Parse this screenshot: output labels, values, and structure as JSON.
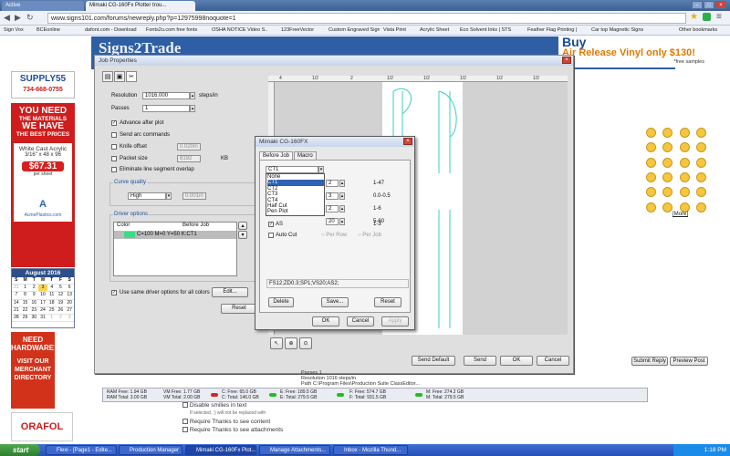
{
  "browser": {
    "tabs": [
      "Active",
      "Mimaki CG-160Fx Plotter trou..."
    ],
    "url": "www.signs101.com/forums/newreply.php?p=12975998noquote=1",
    "bookmarks": [
      "Sign Vox",
      "BCEonline",
      "dafont.com - Download",
      "Fonts2u.com free fonts",
      "OSHA NOTICE Video S..",
      "123FreeVector",
      "Custom Engraved Signs",
      "Vista Print",
      "Acrylic Sheet",
      "Eco Solvent Inks | STS",
      "Feather Flag Printing |",
      "Car top Magnetic Signs",
      "Other bookmarks"
    ]
  },
  "webpage": {
    "banner_brand": "Signs2Trade",
    "banner_ad": {
      "buy": "Buy",
      "release": "Air Release Vinyl only $130!",
      "free": "*free samples"
    },
    "supply_ad": {
      "name": "SUPPLY55",
      "phone": "734-668-0755"
    },
    "red_ad": {
      "line1": "YOU NEED",
      "line2": "THE MATERIALS",
      "line3": "WE HAVE",
      "line4": "THE BEST PRICES",
      "product": "White Cast Acrylic",
      "size": "3/16\" x 48 x 96",
      "price": "$67.31",
      "unit": "per sheet",
      "brand": "AcmePlastics.com"
    },
    "calendar": {
      "title": "August 2016",
      "days": [
        "S",
        "M",
        "T",
        "W",
        "T",
        "F",
        "S"
      ],
      "dates": [
        "31",
        "1",
        "2",
        "3",
        "4",
        "5",
        "6",
        "7",
        "8",
        "9",
        "10",
        "11",
        "12",
        "13",
        "14",
        "15",
        "16",
        "17",
        "18",
        "19",
        "20",
        "21",
        "22",
        "23",
        "24",
        "25",
        "26",
        "27",
        "28",
        "29",
        "30",
        "31",
        "1",
        "2",
        "3"
      ]
    },
    "hw_ad": [
      "NEED",
      "HARDWARE?",
      "VISIT OUR",
      "MERCHANT",
      "DIRECTORY"
    ],
    "orafol": "ORAFOL",
    "more_link": "[More]",
    "reply_buttons": [
      "Submit Reply",
      "Preview Post"
    ],
    "post_options": [
      "Disable smilies in text",
      "If selected, :) will not be replaced with",
      "Require Thanks to see content",
      "Require Thanks to see attachments"
    ]
  },
  "job_properties": {
    "title": "Job Properties",
    "resolution_label": "Resolution",
    "resolution_value": "1016.000",
    "resolution_unit": "steps/in",
    "passes_label": "Passes",
    "passes_value": "1",
    "advance_after_plot": "Advance after plot",
    "send_arc": "Send arc commands",
    "knife_offset": "Knife offset",
    "knife_offset_value": "0.020in",
    "packet_size": "Packet size",
    "packet_size_value": "8192",
    "packet_unit": "KB",
    "eliminate": "Eliminate line segment overlap",
    "curve_quality": "Curve quality",
    "curve_value": "High",
    "curve_extra": "0.001in",
    "driver_options": "Driver options",
    "col_color": "Color",
    "col_before": "Before Job",
    "row_value": "C=100 M=0 Y=50 K:CT1",
    "same_driver": "Use same driver options for all colors",
    "edit_btn": "Edit...",
    "reset_btn": "Reset",
    "ruler_marks": [
      "4",
      "1/2",
      "2",
      "1/2",
      "1/2",
      "1/2",
      "1/2",
      "1/2"
    ],
    "bottom_buttons": [
      "Send Default",
      "Send",
      "OK",
      "Cancel"
    ]
  },
  "mimaki": {
    "title": "Mimaki CG-160FX",
    "tabs": [
      "Before Job",
      "Macro"
    ],
    "ct_value": "CT1",
    "list": [
      "None",
      "CT1",
      "CT2",
      "CT3",
      "CT4",
      "Half Cut",
      "Pen Plot"
    ],
    "rows": [
      {
        "val": "2",
        "range": "1-47"
      },
      {
        "val": "3",
        "range": "0.0-0.5"
      },
      {
        "val": "2",
        "range": "1-6"
      },
      {
        "val": "20",
        "range": "5-60"
      },
      {
        "val": "2",
        "range": "1-3"
      }
    ],
    "as_label": "AS",
    "auto_cut": "Auto Cut",
    "per_row": "Per Row",
    "per_job": "Per Job",
    "command": "FS12;ZD0.3;SP1;VS20;AS2;",
    "delete_btn": "Delete",
    "save_btn": "Save...",
    "reset_btn": "Reset",
    "ok_btn": "OK",
    "cancel_btn": "Cancel",
    "apply_btn": "Apply"
  },
  "status": {
    "ram_free": "RAM Free: 1.94 GB",
    "ram_total": "RAM Total: 3.00 GB",
    "vm_free": "VM Free: 1.77 GB",
    "vm_total": "VM Total: 2.00 GB",
    "c_free": "C: Free: 65.0 GB",
    "c_total": "C: Total: 146.0 GB",
    "e_free": "E: Free: 189.5 GB",
    "e_total": "E: Total: 279.5 GB",
    "f_free": "F: Free: 574.7 GB",
    "f_total": "F: Total: 931.5 GB",
    "m_free": "M: Free: 274.2 GB",
    "m_total": "M: Total: 279.5 GB",
    "info_lines": [
      "Passes 1",
      "Resolution 1016 steps/in",
      "Path C:\\Program Files\\Production Suite ClassEditor..."
    ]
  },
  "taskbar": {
    "start": "start",
    "tasks": [
      "Flexi - [Page1 - Edite...",
      "Production Manager",
      "Mimaki CG-160Fx Plot...",
      "Manage Attachments...",
      "Inbox - Mozilla Thund..."
    ],
    "time": "1:18 PM"
  },
  "colors": {
    "accent": "#2f62b5",
    "swatch": "#3ddc84",
    "cut_path": "#35d0c6"
  }
}
